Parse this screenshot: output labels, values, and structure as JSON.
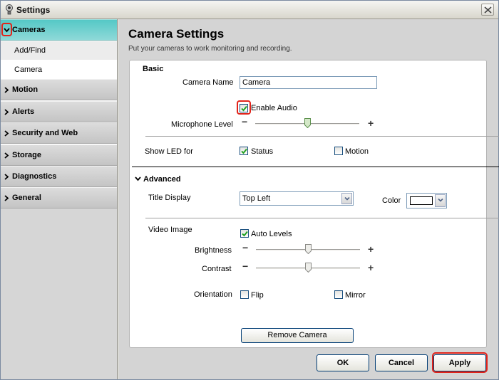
{
  "window": {
    "title": "Settings"
  },
  "sidebar": {
    "sections": [
      {
        "label": "Cameras",
        "expanded": true
      },
      {
        "label": "Motion"
      },
      {
        "label": "Alerts"
      },
      {
        "label": "Security and Web"
      },
      {
        "label": "Storage"
      },
      {
        "label": "Diagnostics"
      },
      {
        "label": "General"
      }
    ],
    "sub_items": [
      {
        "label": "Add/Find"
      },
      {
        "label": "Camera",
        "selected": true
      }
    ]
  },
  "main": {
    "title": "Camera Settings",
    "subtitle": "Put your cameras to work monitoring and recording."
  },
  "basic": {
    "heading": "Basic",
    "camera_name_label": "Camera Name",
    "camera_name_value": "Camera",
    "enable_audio_label": "Enable Audio",
    "enable_audio_checked": true,
    "microphone_label": "Microphone Level",
    "microphone_level": 0.5,
    "minus": "−",
    "plus": "+",
    "show_led_label": "Show LED for",
    "led_status_label": "Status",
    "led_status_checked": true,
    "led_motion_label": "Motion",
    "led_motion_checked": false
  },
  "advanced": {
    "heading": "Advanced",
    "title_display_label": "Title Display",
    "title_display_value": "Top Left",
    "color_label": "Color",
    "color_value": "#ffffff",
    "video_image_label": "Video Image",
    "auto_levels_label": "Auto Levels",
    "auto_levels_checked": true,
    "brightness_label": "Brightness",
    "brightness_level": 0.5,
    "contrast_label": "Contrast",
    "contrast_level": 0.5,
    "orientation_label": "Orientation",
    "flip_label": "Flip",
    "mirror_label": "Mirror",
    "remove_camera_label": "Remove Camera"
  },
  "footer": {
    "ok_label": "OK",
    "cancel_label": "Cancel",
    "apply_label": "Apply"
  },
  "colors": {
    "highlight": "#e2231a",
    "active_nav": "#55c8c6"
  }
}
